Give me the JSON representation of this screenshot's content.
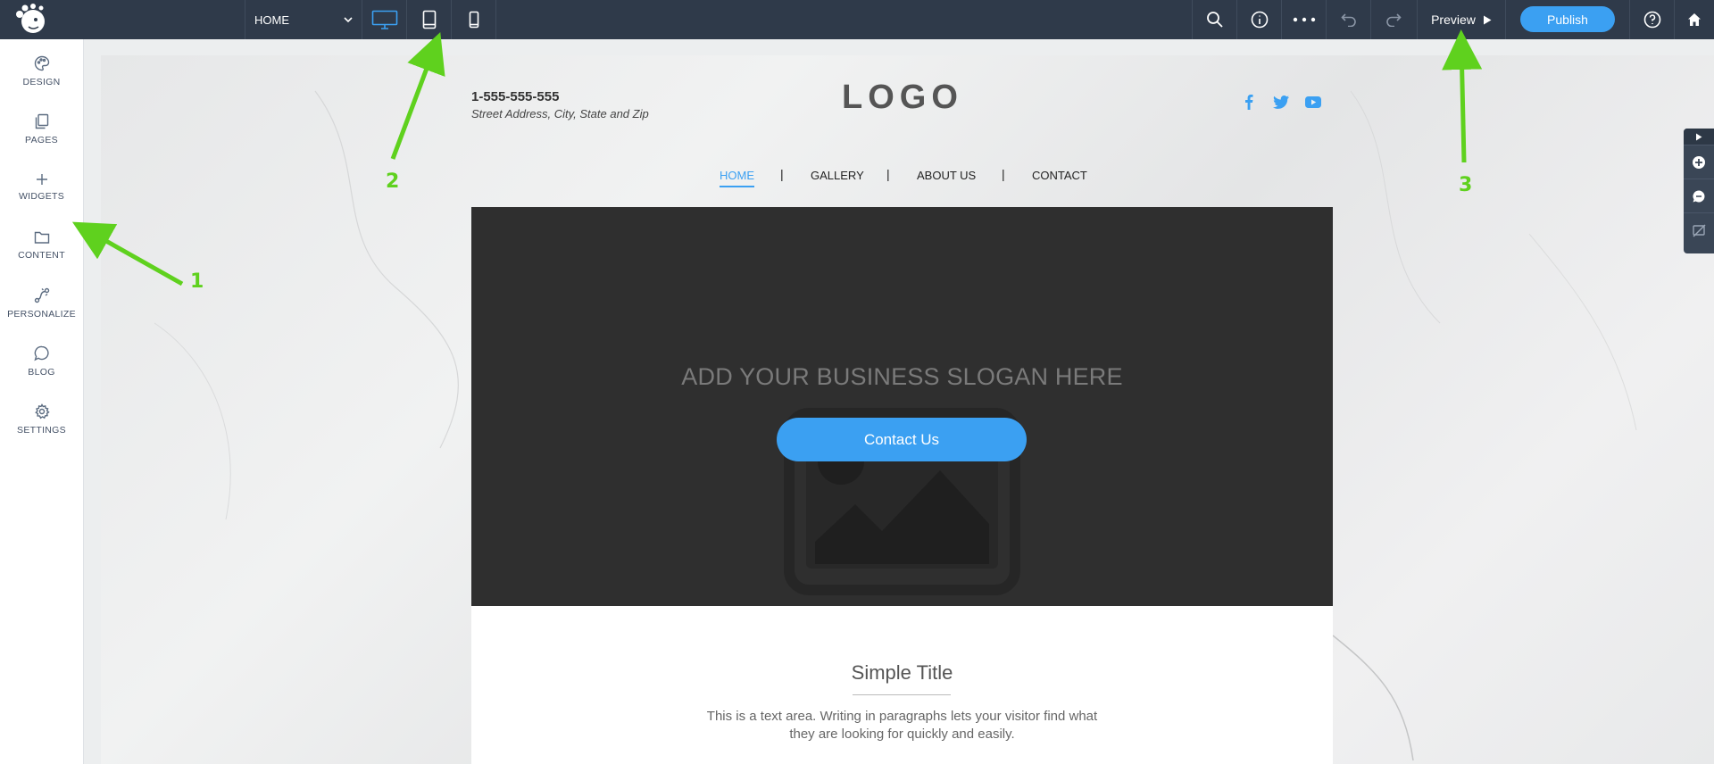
{
  "topbar": {
    "page_selector": "HOME",
    "preview_label": "Preview",
    "publish_label": "Publish"
  },
  "sidebar": {
    "items": [
      {
        "label": "DESIGN",
        "icon": "palette-icon"
      },
      {
        "label": "PAGES",
        "icon": "pages-icon"
      },
      {
        "label": "WIDGETS",
        "icon": "plus-icon"
      },
      {
        "label": "CONTENT",
        "icon": "folder-icon"
      },
      {
        "label": "PERSONALIZE",
        "icon": "personalize-icon"
      },
      {
        "label": "BLOG",
        "icon": "chat-bubble-icon"
      },
      {
        "label": "SETTINGS",
        "icon": "gear-icon"
      }
    ]
  },
  "site": {
    "phone": "1-555-555-555",
    "address": "Street Address, City, State and Zip",
    "logo": "LOGO",
    "nav": [
      "HOME",
      "GALLERY",
      "ABOUT US",
      "CONTACT"
    ],
    "nav_separator": "|",
    "slogan": "ADD YOUR BUSINESS SLOGAN HERE",
    "cta": "Contact Us",
    "section_title": "Simple Title",
    "section_text": "This is a text area. Writing in paragraphs lets your visitor find what they are looking for quickly and easily."
  },
  "annotations": [
    "1",
    "2",
    "3"
  ],
  "colors": {
    "topbar": "#2f3a4a",
    "accent": "#3ba0f2",
    "annotation": "#5fd11e",
    "hero": "#2f2f2f"
  }
}
